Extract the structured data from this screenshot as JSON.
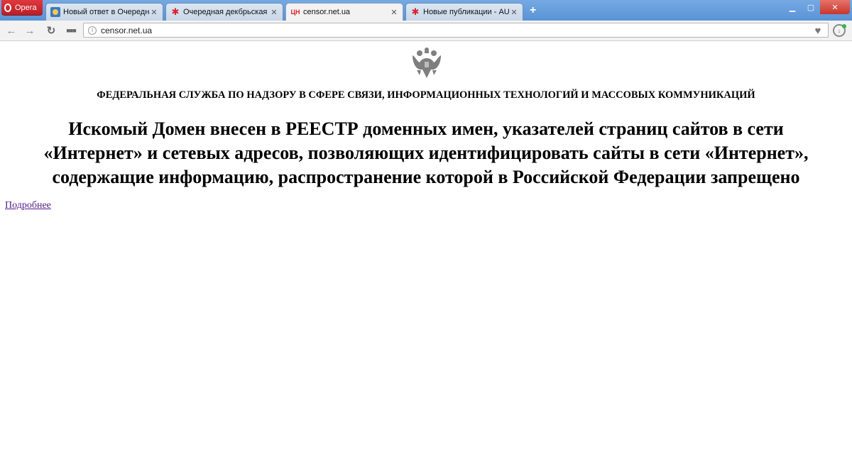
{
  "browser": {
    "menu_label": "Opera",
    "tabs": [
      {
        "title": "Новый ответ в Очередная",
        "favicon": "forum-icon",
        "active": false
      },
      {
        "title": "Очередная декбрьская ес",
        "favicon": "star-icon",
        "active": false
      },
      {
        "title": "censor.net.ua",
        "favicon": "ЦН",
        "active": true
      },
      {
        "title": "Новые публикации - AUT",
        "favicon": "star-icon",
        "active": false
      }
    ],
    "new_tab_label": "+",
    "address": "censor.net.ua",
    "accent_color": "#5a93d6",
    "opera_color": "#d8232a"
  },
  "page": {
    "agency": "ФЕДЕРАЛЬНАЯ СЛУЖБА ПО НАДЗОРУ В СФЕРЕ СВЯЗИ, ИНФОРМАЦИОННЫХ ТЕХНОЛОГИЙ И МАССОВЫХ КОММУНИКАЦИЙ",
    "headline_lines": [
      "Искомый Домен внесен в РЕЕСТР доменных имен, указателей страниц сайтов в сети",
      "«Интернет» и сетевых адресов, позволяющих идентифицировать сайты в сети «Интернет»,",
      "содержащие информацию, распространение которой в Российской Федерации запрещено"
    ],
    "more_link": "Подробнее"
  }
}
